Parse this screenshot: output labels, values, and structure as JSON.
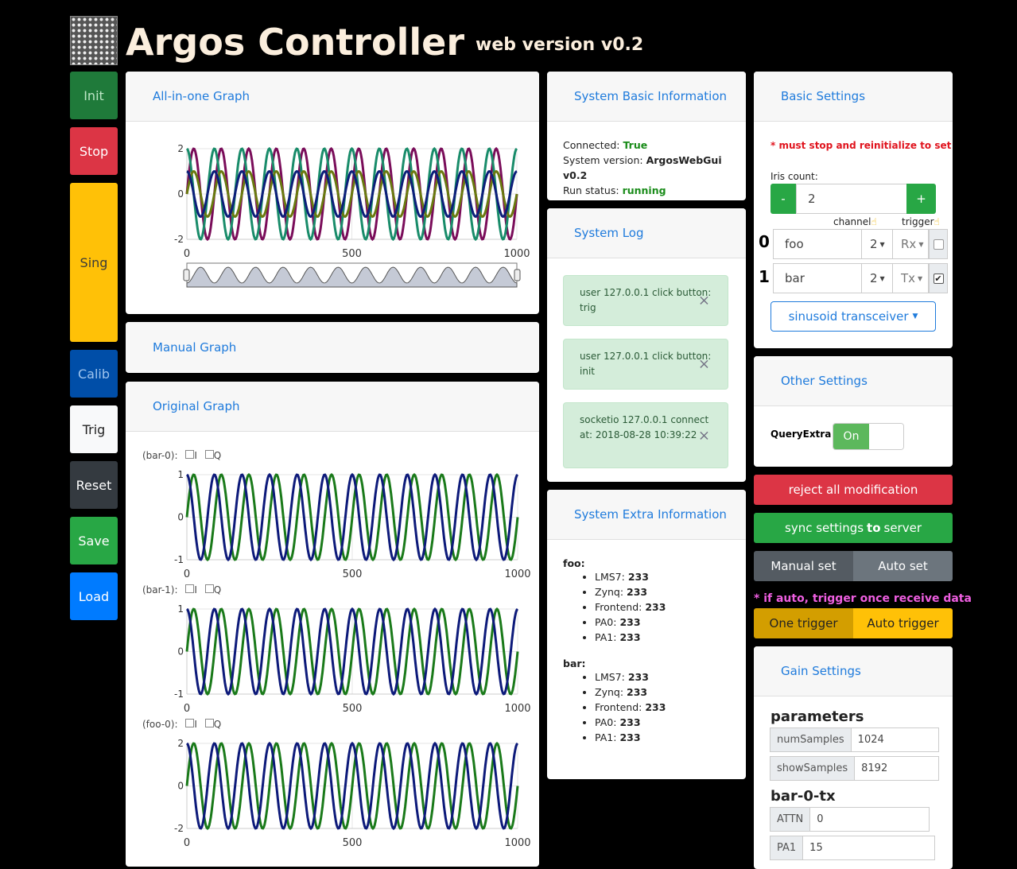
{
  "header": {
    "title": "Argos Controller",
    "subtitle": "web version v0.2"
  },
  "sidebar": {
    "init": "Init",
    "stop": "Stop",
    "sing": "Sing",
    "calib": "Calib",
    "trig": "Trig",
    "reset": "Reset",
    "save": "Save",
    "load": "Load"
  },
  "graphs": {
    "all_in_one": "All-in-one Graph",
    "manual": "Manual Graph",
    "original": "Original Graph",
    "sub_labels": [
      "(bar-0):",
      "(bar-1):",
      "(foo-0):"
    ],
    "i_label": "I",
    "q_label": "Q"
  },
  "sysinfo": {
    "title": "System Basic Information",
    "connected_label": "Connected:",
    "connected": "True",
    "version_label": "System version:",
    "version": "ArgosWebGui v0.2",
    "status_label": "Run status:",
    "status": "running"
  },
  "syslog": {
    "title": "System Log",
    "entries": [
      {
        "text": "user 127.0.0.1 click button: trig"
      },
      {
        "text": "user 127.0.0.1 click button: init"
      },
      {
        "text": "socketio 127.0.0.1 connect at: 2018-08-28 10:39:22"
      }
    ],
    "close": "×"
  },
  "extra": {
    "title": "System Extra Information",
    "devices": [
      {
        "name": "foo:",
        "items": [
          {
            "k": "LMS7:",
            "v": "233"
          },
          {
            "k": "Zynq:",
            "v": "233"
          },
          {
            "k": "Frontend:",
            "v": "233"
          },
          {
            "k": "PA0:",
            "v": "233"
          },
          {
            "k": "PA1:",
            "v": "233"
          }
        ]
      },
      {
        "name": "bar:",
        "items": [
          {
            "k": "LMS7:",
            "v": "233"
          },
          {
            "k": "Zynq:",
            "v": "233"
          },
          {
            "k": "Frontend:",
            "v": "233"
          },
          {
            "k": "PA0:",
            "v": "233"
          },
          {
            "k": "PA1:",
            "v": "233"
          }
        ]
      }
    ]
  },
  "basic": {
    "title": "Basic Settings",
    "warning": "* must stop and reinitialize to set",
    "iris_label": "Iris count:",
    "minus": "-",
    "plus": "+",
    "iris_count": "2",
    "channel_label": "channel",
    "trigger_label": "trigger",
    "rows": [
      {
        "idx": "0",
        "name": "foo",
        "channel": "2",
        "dir": "Rx",
        "trigger": false
      },
      {
        "idx": "1",
        "name": "bar",
        "channel": "2",
        "dir": "Tx",
        "trigger": true
      }
    ],
    "mode": "sinusoid transceiver"
  },
  "other": {
    "title": "Other Settings",
    "query_label": "QueryExtra",
    "toggle": "On"
  },
  "actions": {
    "reject": "reject all modification",
    "sync_pre": "sync settings ",
    "sync_bold": "to",
    "sync_post": " server",
    "manual_set": "Manual set",
    "auto_set": "Auto set",
    "auto_note": "* if auto, trigger once receive data",
    "one_trigger": "One trigger",
    "auto_trigger": "Auto trigger"
  },
  "gain": {
    "title": "Gain Settings",
    "section1": "parameters",
    "params": [
      {
        "k": "numSamples",
        "v": "1024"
      },
      {
        "k": "showSamples",
        "v": "8192"
      }
    ],
    "section2": "bar-0-tx",
    "tx": [
      {
        "k": "ATTN",
        "v": "0"
      },
      {
        "k": "PA1",
        "v": "15"
      }
    ]
  },
  "chart_data": [
    {
      "type": "line",
      "title": "",
      "xlim": [
        0,
        1000
      ],
      "ylim": [
        -2,
        2
      ],
      "xticks": [
        "0",
        "500",
        "1000"
      ],
      "yticks": [
        "2",
        "0",
        "-2"
      ],
      "series": [
        {
          "color": "#7a0d5a",
          "amplitude": 2,
          "cycles": 12,
          "phase": 0
        },
        {
          "color": "#198c6a",
          "amplitude": 2,
          "cycles": 12,
          "phase": 1.57
        },
        {
          "color": "#6a7a10",
          "amplitude": 1,
          "cycles": 12,
          "phase": 0
        },
        {
          "color": "#0d1f7a",
          "amplitude": 1,
          "cycles": 12,
          "phase": 1.57
        }
      ]
    },
    {
      "type": "line",
      "title": "",
      "xlim": [
        0,
        1000
      ],
      "ylim": [
        -1,
        1
      ],
      "xticks": [
        "0",
        "500",
        "1000"
      ],
      "yticks": [
        "1",
        "0",
        "-1"
      ],
      "series": [
        {
          "color": "#1a7a1a",
          "amplitude": 1,
          "cycles": 12,
          "phase": 0
        },
        {
          "color": "#0d1a7a",
          "amplitude": 1,
          "cycles": 12,
          "phase": 1.57
        }
      ]
    },
    {
      "type": "line",
      "title": "",
      "xlim": [
        0,
        1000
      ],
      "ylim": [
        -1,
        1
      ],
      "xticks": [
        "0",
        "500",
        "1000"
      ],
      "yticks": [
        "1",
        "0",
        "-1"
      ],
      "series": [
        {
          "color": "#1a7a1a",
          "amplitude": 1,
          "cycles": 12,
          "phase": 0
        },
        {
          "color": "#0d1a7a",
          "amplitude": 1,
          "cycles": 12,
          "phase": 1.57
        }
      ]
    },
    {
      "type": "line",
      "title": "",
      "xlim": [
        0,
        1000
      ],
      "ylim": [
        -2,
        2
      ],
      "xticks": [
        "0",
        "500",
        "1000"
      ],
      "yticks": [
        "2",
        "0",
        "-2"
      ],
      "series": [
        {
          "color": "#1a7a1a",
          "amplitude": 2,
          "cycles": 12,
          "phase": 0
        },
        {
          "color": "#0d1a7a",
          "amplitude": 2,
          "cycles": 12,
          "phase": 1.57
        }
      ]
    }
  ]
}
